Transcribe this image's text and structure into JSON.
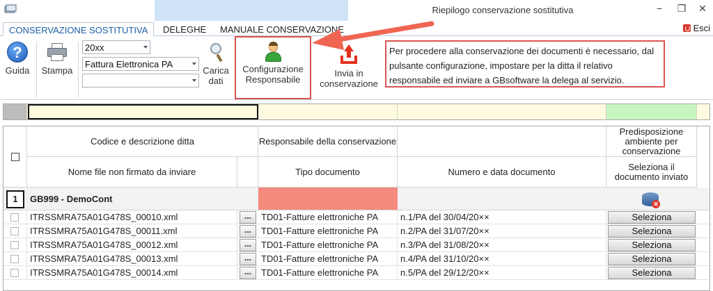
{
  "window": {
    "title": "Riepilogo conservazione sostitutiva",
    "minimize": "−",
    "restore": "❐",
    "close": "✕"
  },
  "tabs": [
    {
      "label": "CONSERVAZIONE SOSTITUTIVA",
      "active": true
    },
    {
      "label": "DELEGHE",
      "active": false
    },
    {
      "label": "MANUALE CONSERVAZIONE",
      "active": false
    }
  ],
  "exit_label": "Esci",
  "ribbon": {
    "guida": "Guida",
    "stampa": "Stampa",
    "year_value": "20xx",
    "doc_type_value": "Fattura Elettronica PA",
    "third_value": "",
    "carica_line1": "Carica",
    "carica_line2": "dati",
    "config_line1": "Configurazione",
    "config_line2": "Responsabile",
    "invia_line1": "Invia in",
    "invia_line2": "conservazione",
    "info_text": "Per procedere alla conservazione dei documenti è necessario, dal pulsante configurazione, impostare per la ditta il relativo responsabile ed inviare a GBsoftware la delega al servizio."
  },
  "colors": {
    "accent": "#1e5fa8",
    "annotation_red": "#d9534f",
    "filter_yellow": "#fffbe0",
    "filter_green": "#c6f5c0",
    "responsible_red": "#f58a7e"
  },
  "grid": {
    "headers": {
      "codice": "Codice e descrizione ditta",
      "responsabile": "Responsabile della conservazione",
      "predisposizione": "Predisposizione ambiente per conservazione",
      "nome_file": "Nome file non firmato da inviare",
      "tipo_documento": "Tipo documento",
      "numero_data": "Numero e data documento",
      "seleziona_il": "Seleziona il documento inviato"
    },
    "group": {
      "number": "1",
      "name": "GB999 - DemoCont"
    },
    "ellipsis": "...",
    "select_label": "Seleziona",
    "rows": [
      {
        "file": "ITRSSMRA75A01G478S_00010.xml",
        "tipo": "TD01-Fatture elettroniche PA",
        "numero": "n.1/PA del 30/04/20××"
      },
      {
        "file": "ITRSSMRA75A01G478S_00011.xml",
        "tipo": "TD01-Fatture elettroniche PA",
        "numero": "n.2/PA del 31/07/20××"
      },
      {
        "file": "ITRSSMRA75A01G478S_00012.xml",
        "tipo": "TD01-Fatture elettroniche PA",
        "numero": "n.3/PA del 31/08/20××"
      },
      {
        "file": "ITRSSMRA75A01G478S_00013.xml",
        "tipo": "TD01-Fatture elettroniche PA",
        "numero": "n.4/PA del 31/10/20××"
      },
      {
        "file": "ITRSSMRA75A01G478S_00014.xml",
        "tipo": "TD01-Fatture elettroniche PA",
        "numero": "n.5/PA del 29/12/20××"
      }
    ]
  }
}
